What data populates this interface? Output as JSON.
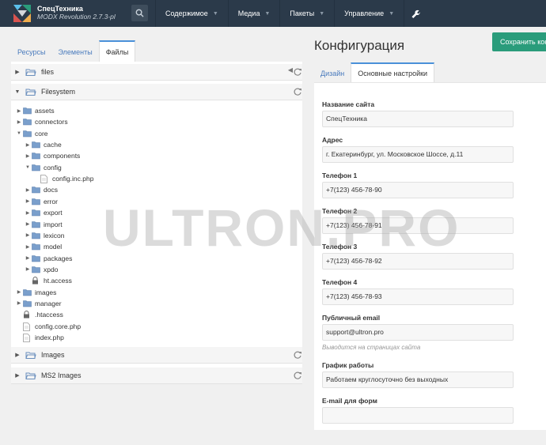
{
  "header": {
    "site_name": "СпецТехника",
    "version": "MODX Revolution 2.7.3-pl",
    "nav": [
      {
        "label": "Содержимое"
      },
      {
        "label": "Медиа"
      },
      {
        "label": "Пакеты"
      },
      {
        "label": "Управление"
      }
    ]
  },
  "left": {
    "tabs": [
      "Ресурсы",
      "Элементы",
      "Файлы"
    ],
    "sections": {
      "files": "files",
      "filesystem": "Filesystem",
      "images": "Images",
      "ms2images": "MS2 Images"
    },
    "tree": [
      {
        "label": "assets",
        "type": "folder",
        "depth": 0,
        "expanded": false
      },
      {
        "label": "connectors",
        "type": "folder",
        "depth": 0,
        "expanded": false
      },
      {
        "label": "core",
        "type": "folder",
        "depth": 0,
        "expanded": true
      },
      {
        "label": "cache",
        "type": "folder",
        "depth": 1,
        "expanded": false
      },
      {
        "label": "components",
        "type": "folder",
        "depth": 1,
        "expanded": false
      },
      {
        "label": "config",
        "type": "folder",
        "depth": 1,
        "expanded": true
      },
      {
        "label": "config.inc.php",
        "type": "file",
        "depth": 2
      },
      {
        "label": "docs",
        "type": "folder",
        "depth": 1,
        "expanded": false
      },
      {
        "label": "error",
        "type": "folder",
        "depth": 1,
        "expanded": false
      },
      {
        "label": "export",
        "type": "folder",
        "depth": 1,
        "expanded": false
      },
      {
        "label": "import",
        "type": "folder",
        "depth": 1,
        "expanded": false
      },
      {
        "label": "lexicon",
        "type": "folder",
        "depth": 1,
        "expanded": false
      },
      {
        "label": "model",
        "type": "folder",
        "depth": 1,
        "expanded": false
      },
      {
        "label": "packages",
        "type": "folder",
        "depth": 1,
        "expanded": false
      },
      {
        "label": "xpdo",
        "type": "folder",
        "depth": 1,
        "expanded": false
      },
      {
        "label": "ht.access",
        "type": "lock",
        "depth": 1
      },
      {
        "label": "images",
        "type": "folder",
        "depth": 0,
        "expanded": false
      },
      {
        "label": "manager",
        "type": "folder",
        "depth": 0,
        "expanded": false
      },
      {
        "label": ".htaccess",
        "type": "lock",
        "depth": 0
      },
      {
        "label": "config.core.php",
        "type": "file",
        "depth": 0
      },
      {
        "label": "index.php",
        "type": "file",
        "depth": 0
      }
    ]
  },
  "right": {
    "title": "Конфигурация",
    "save_label": "Сохранить конфигурацию",
    "tabs": [
      "Дизайн",
      "Основные настройки"
    ],
    "fields": [
      {
        "label": "Название сайта",
        "value": "СпецТехника"
      },
      {
        "label": "Адрес",
        "value": "г. Екатеринбург, ул. Московское Шоссе, д.11"
      },
      {
        "label": "Телефон 1",
        "value": "+7(123) 456-78-90"
      },
      {
        "label": "Телефон 2",
        "value": "+7(123) 456-78-91"
      },
      {
        "label": "Телефон 3",
        "value": "+7(123) 456-78-92"
      },
      {
        "label": "Телефон 4",
        "value": "+7(123) 456-78-93"
      },
      {
        "label": "Публичный email",
        "value": "support@ultron.pro",
        "hint": "Выводится на страницах сайта"
      },
      {
        "label": "График работы",
        "value": "Работаем круглосуточно без выходных"
      },
      {
        "label": "E-mail для форм",
        "value": ""
      }
    ]
  },
  "watermark": "ULTRON.PRO",
  "colors": {
    "topbar": "#2b3a4a",
    "accent": "#4a90d9",
    "save": "#2a9c7b",
    "folder": "#7a9fcc"
  }
}
